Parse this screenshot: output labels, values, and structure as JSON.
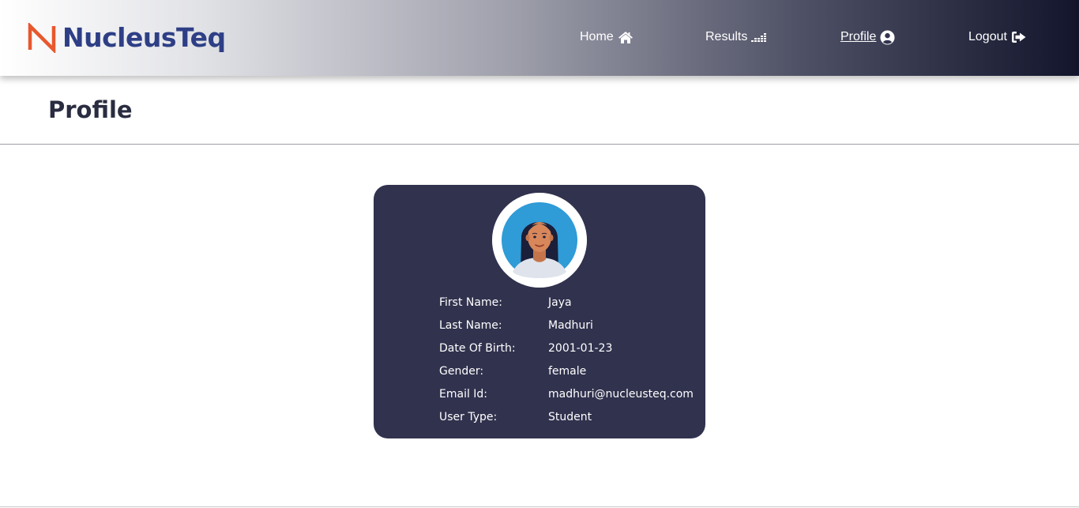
{
  "brand": {
    "name": "NucleusTeq",
    "mark_color": "#e8572d",
    "text_color": "#2e3f86"
  },
  "nav": {
    "items": [
      {
        "label": "Home",
        "icon": "home-icon",
        "active": false
      },
      {
        "label": "Results",
        "icon": "results-bars-icon",
        "active": false
      },
      {
        "label": "Profile",
        "icon": "user-circle-icon",
        "active": true
      },
      {
        "label": "Logout",
        "icon": "logout-icon",
        "active": false
      }
    ]
  },
  "page": {
    "title": "Profile"
  },
  "profile": {
    "avatar": "avatar-woman-image",
    "fields": [
      {
        "label": "First Name:",
        "value": "Jaya"
      },
      {
        "label": "Last Name:",
        "value": "Madhuri"
      },
      {
        "label": "Date Of Birth:",
        "value": "2001-01-23"
      },
      {
        "label": "Gender:",
        "value": "female"
      },
      {
        "label": "Email Id:",
        "value": "madhuri@nucleusteq.com"
      },
      {
        "label": "User Type:",
        "value": "Student"
      }
    ]
  },
  "colors": {
    "card_bg": "#31324e",
    "title": "#2a2c40"
  }
}
